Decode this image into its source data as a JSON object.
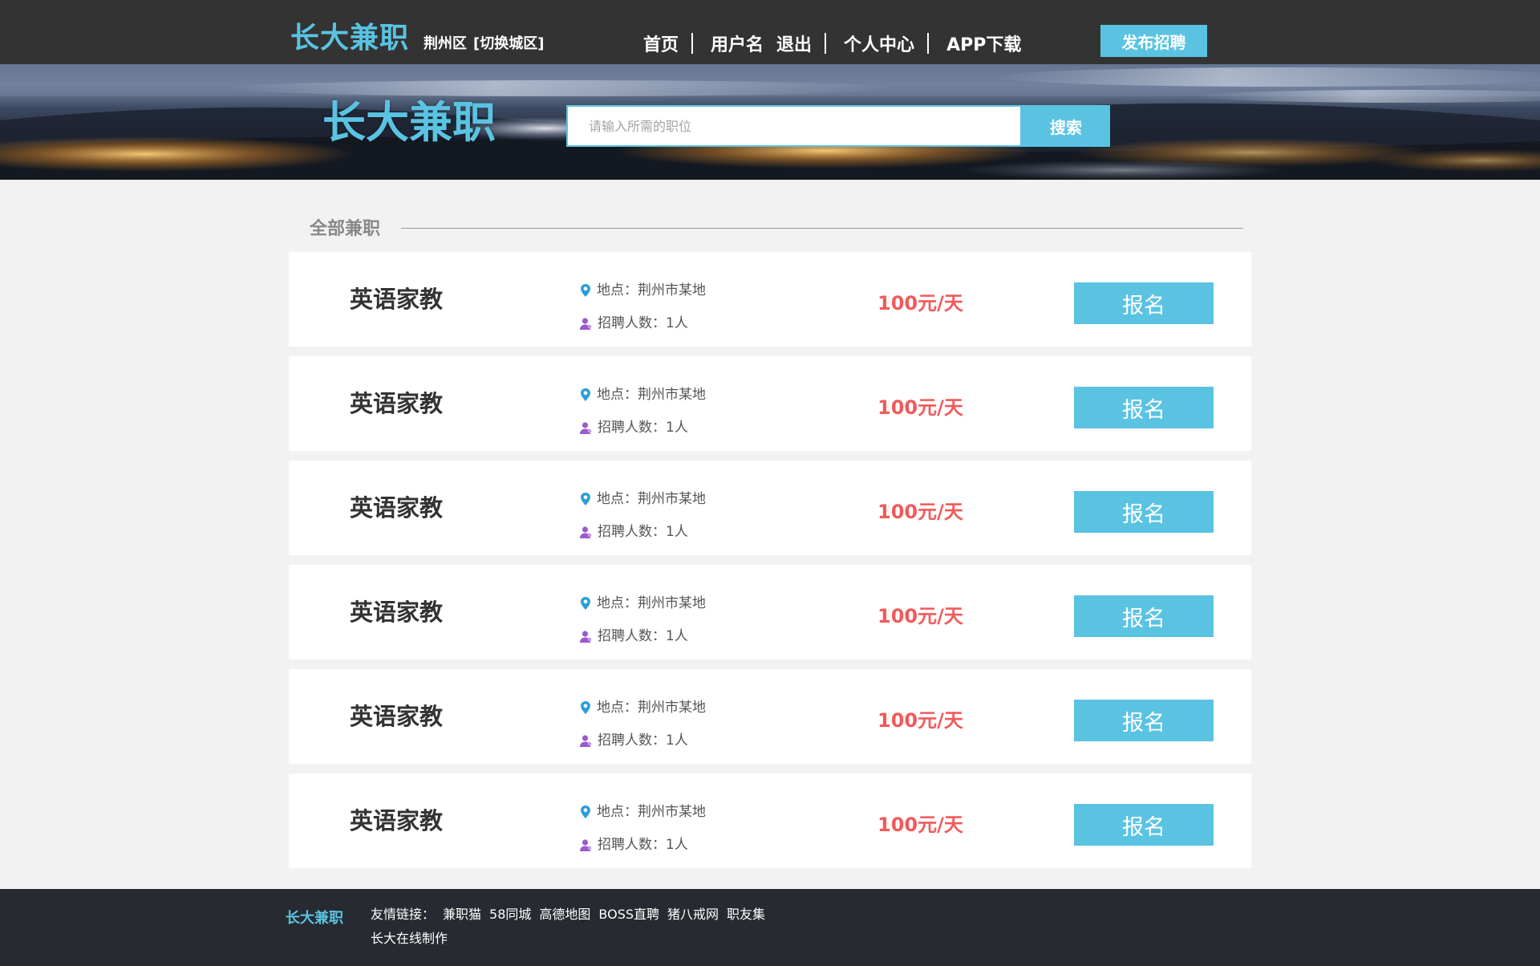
{
  "header": {
    "logo": "长大兼职",
    "city": "荆州区",
    "switch_city": "[切换城区]",
    "nav": {
      "home": "首页",
      "username": "用户名",
      "logout": "退出",
      "profile": "个人中心",
      "app": "APP下载"
    },
    "publish": "发布招聘"
  },
  "banner": {
    "logo": "长大兼职",
    "search_placeholder": "请输入所需的职位",
    "search_button": "搜索"
  },
  "section": {
    "title": "全部兼职"
  },
  "jobs": [
    {
      "title": "英语家教",
      "location": "地点：荆州市某地",
      "count": "招聘人数：1人",
      "salary": "100元/天",
      "apply": "报名"
    },
    {
      "title": "英语家教",
      "location": "地点：荆州市某地",
      "count": "招聘人数：1人",
      "salary": "100元/天",
      "apply": "报名"
    },
    {
      "title": "英语家教",
      "location": "地点：荆州市某地",
      "count": "招聘人数：1人",
      "salary": "100元/天",
      "apply": "报名"
    },
    {
      "title": "英语家教",
      "location": "地点：荆州市某地",
      "count": "招聘人数：1人",
      "salary": "100元/天",
      "apply": "报名"
    },
    {
      "title": "英语家教",
      "location": "地点：荆州市某地",
      "count": "招聘人数：1人",
      "salary": "100元/天",
      "apply": "报名"
    },
    {
      "title": "英语家教",
      "location": "地点：荆州市某地",
      "count": "招聘人数：1人",
      "salary": "100元/天",
      "apply": "报名"
    }
  ],
  "footer": {
    "logo": "长大兼职",
    "links_label": "友情链接：",
    "links": [
      "兼职猫",
      "58同城",
      "高德地图",
      "BOSS直聘",
      "猪八戒网",
      "职友集"
    ],
    "credit": "长大在线制作"
  },
  "icons": {
    "location": "map-pin-icon",
    "people": "user-icon"
  },
  "colors": {
    "accent": "#5ac3e2",
    "salary": "#f25a5a",
    "topbar": "#333333",
    "footer": "#272a30",
    "background": "#f2f2f2",
    "location_icon": "#2a9fd6",
    "people_icon": "#9b59d0"
  }
}
